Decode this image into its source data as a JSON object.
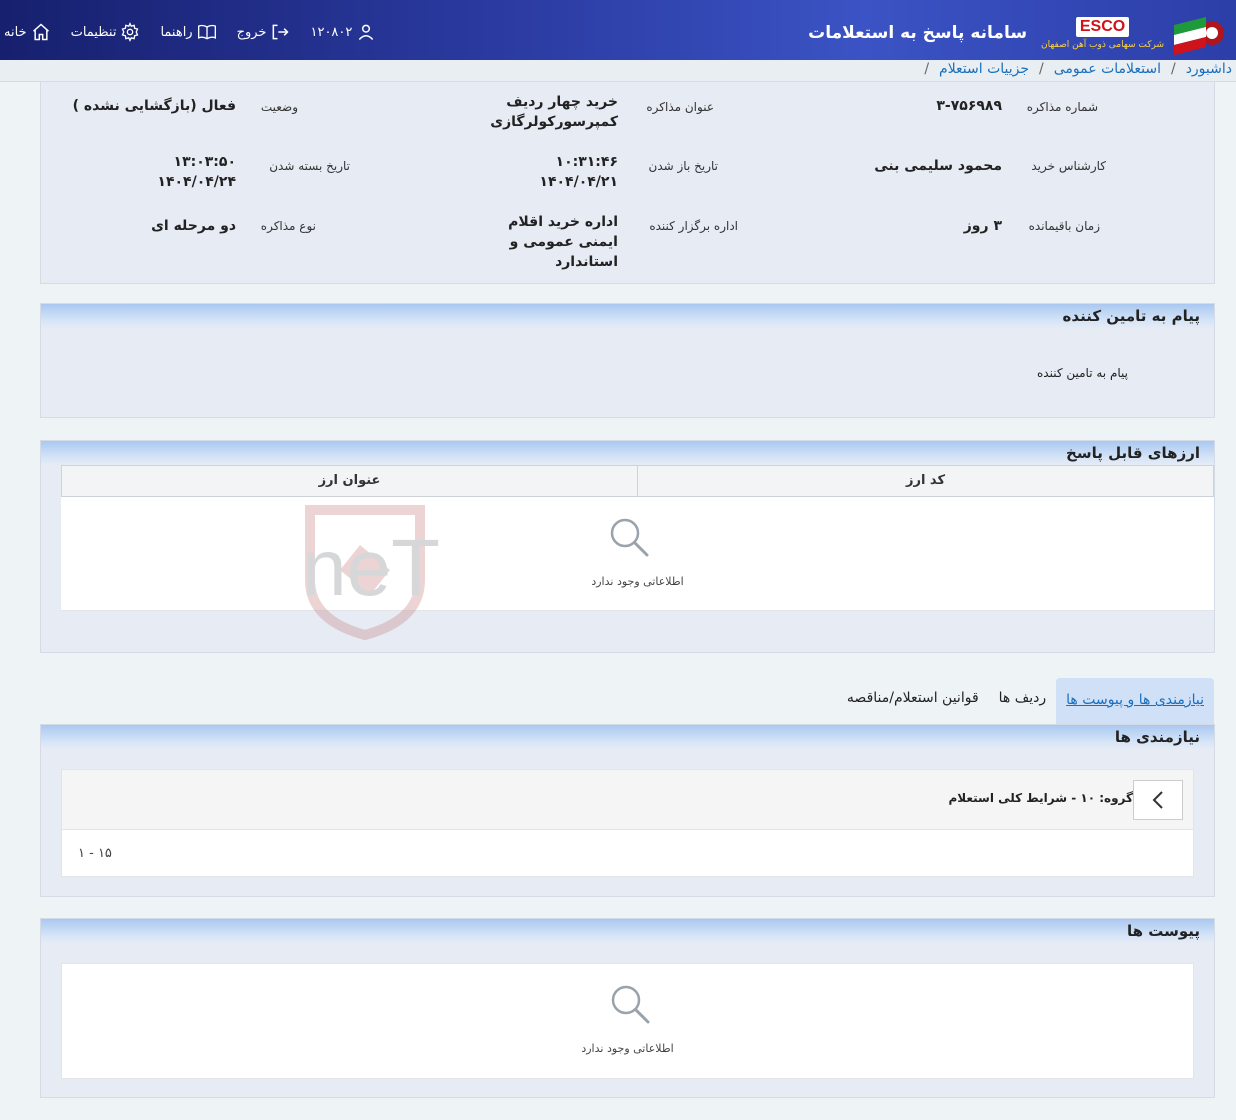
{
  "header": {
    "app_title": "سامانه پاسخ به استعلامات",
    "brand_logo": "ESCO",
    "brand_subtitle": "شرکت سهامی ذوب آهن اصفهان",
    "nav": {
      "home": "خانه",
      "settings": "تنظیمات",
      "guide": "راهنما",
      "logout": "خروج",
      "user_id": "۱۲۰۸۰۲"
    }
  },
  "breadcrumb": [
    "داشبورد",
    "استعلامات عمومی",
    "جزییات استعلام"
  ],
  "details": {
    "number_label": "شماره مذاکره",
    "number_value": "۳-۷۵۶۹۸۹",
    "title_label": "عنوان مذاکره",
    "title_value": "خرید چهار ردیف کمپرسورکولرگازی",
    "status_label": "وضعیت",
    "status_value": "فعال (بازگشایی نشده )",
    "expert_label": "کارشناس خرید",
    "expert_value": "محمود سلیمی بنی",
    "open_date_label": "تاریخ باز شدن",
    "open_time": "۱۰:۳۱:۴۶",
    "open_date": "۱۴۰۴/۰۴/۲۱",
    "close_date_label": "تاریخ بسته شدن",
    "close_time": "۱۳:۰۳:۵۰",
    "close_date": "۱۴۰۴/۰۴/۲۴",
    "remaining_label": "زمان باقیمانده",
    "remaining_value": "۳ روز",
    "organizer_label": "اداره برگزار کننده",
    "organizer_value": "اداره خرید اقلام ایمنی عمومی و استاندارد",
    "type_label": "نوع مذاکره",
    "type_value": "دو مرحله ای"
  },
  "supplier_message": {
    "title": "پیام به تامین کننده",
    "text": "پیام به تامین کننده"
  },
  "currencies": {
    "title": "ارزهای قابل پاسخ",
    "columns": [
      "کد ارز",
      "عنوان ارز"
    ],
    "empty_text": "اطلاعاتی وجود ندارد"
  },
  "tabs": [
    "نیازمندی ها و پیوست ها",
    "ردیف ها",
    "قوانین استعلام/مناقصه"
  ],
  "requirements": {
    "title": "نیازمندی ها",
    "group_title": "گروه: ۱۰ - شرایط کلی استعلام",
    "pager": "۱ - ۱۵"
  },
  "attachments": {
    "title": "پیوست ها",
    "empty_text": "اطلاعاتی وجود ندارد"
  },
  "watermark": "AriaTender.neT",
  "colors": {
    "header_bg": "#2a3aa0",
    "link": "#1a6fbf",
    "panel_head": "#aac8f0",
    "panel_bg": "#e6ebf4"
  }
}
